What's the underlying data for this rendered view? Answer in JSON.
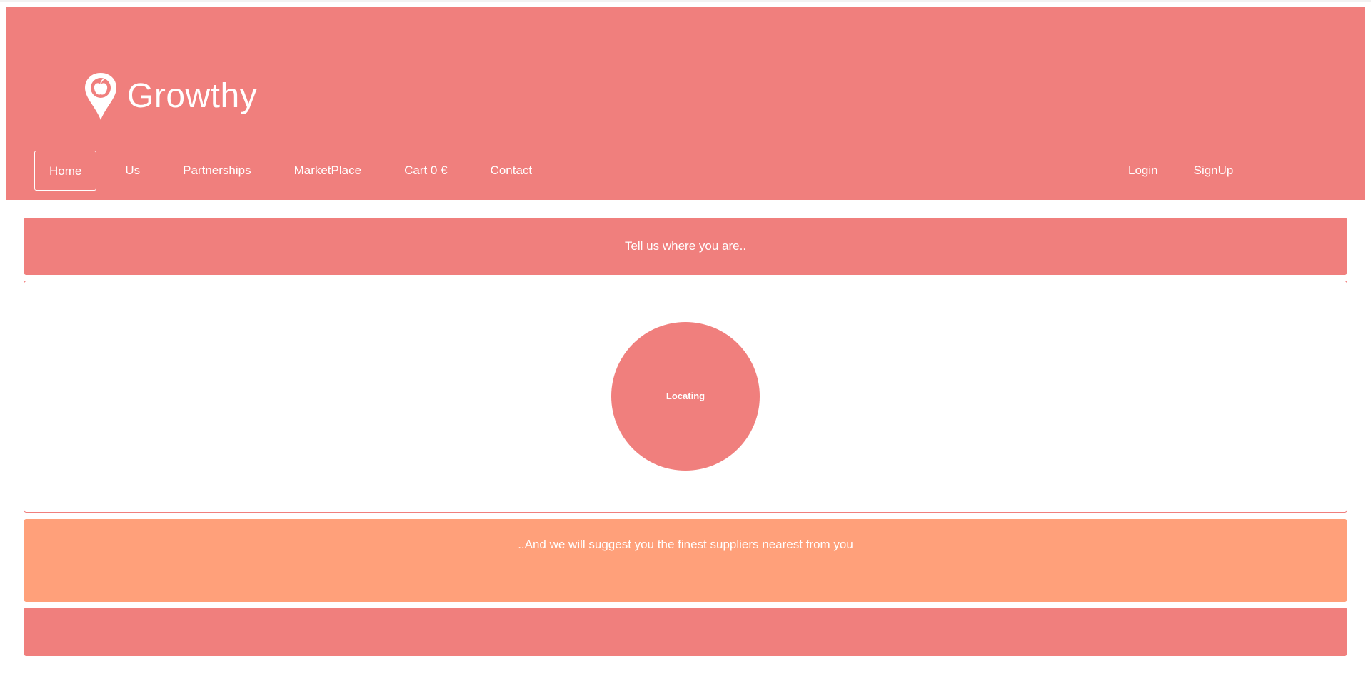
{
  "brand": {
    "name": "Growthy",
    "icon": "map-pin-apple-icon"
  },
  "nav": {
    "left": [
      {
        "label": "Home",
        "active": true
      },
      {
        "label": "Us"
      },
      {
        "label": "Partnerships"
      },
      {
        "label": "MarketPlace"
      },
      {
        "label": "Cart 0 €"
      },
      {
        "label": "Contact"
      }
    ],
    "right": [
      {
        "label": "Login"
      },
      {
        "label": "SignUp"
      }
    ]
  },
  "main": {
    "tell_text": "Tell us where you are..",
    "locating_label": "Locating",
    "suggest_text": "..And we will suggest you the finest suppliers nearest from you"
  },
  "colors": {
    "primary": "#f07f7d",
    "secondary": "#ffa07a",
    "text_on_primary": "#ffffff"
  }
}
